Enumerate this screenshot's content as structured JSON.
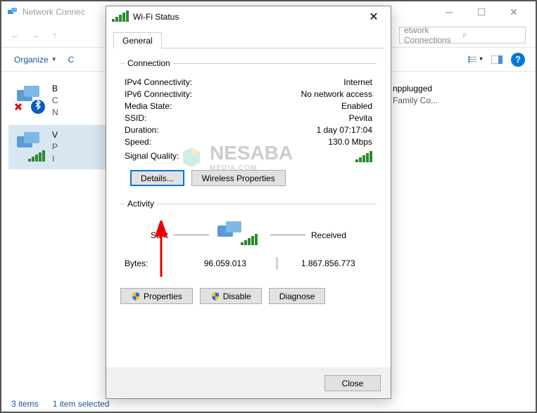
{
  "explorer": {
    "title": "Network Connec",
    "search_placeholder": "etwork Connections",
    "toolbar": {
      "organize": "Organize",
      "c": "C"
    },
    "connections": [
      {
        "name": "B",
        "line2": "C",
        "line3": "N",
        "bluetooth": true,
        "disabled": true
      },
      {
        "name": "V",
        "line2": "P",
        "line3": "I",
        "wifi": true,
        "selected": true
      }
    ],
    "right_conn": {
      "line2": "npplugged",
      "line3": "Family Co..."
    },
    "status": {
      "items": "3 items",
      "selected": "1 item selected"
    }
  },
  "dialog": {
    "title": "Wi-Fi Status",
    "tab": "General",
    "connection": {
      "legend": "Connection",
      "rows": [
        {
          "label": "IPv4 Connectivity:",
          "value": "Internet"
        },
        {
          "label": "IPv6 Connectivity:",
          "value": "No network access"
        },
        {
          "label": "Media State:",
          "value": "Enabled"
        },
        {
          "label": "SSID:",
          "value": "Pevita"
        },
        {
          "label": "Duration:",
          "value": "1 day 07:17:04"
        },
        {
          "label": "Speed:",
          "value": "130.0 Mbps"
        }
      ],
      "signal_label": "Signal Quality:",
      "details_btn": "Details...",
      "wireless_btn": "Wireless Properties"
    },
    "activity": {
      "legend": "Activity",
      "sent_label": "Sent",
      "received_label": "Received",
      "bytes_label": "Bytes:",
      "bytes_sent": "96.059.013",
      "bytes_received": "1.867.856.773"
    },
    "buttons": {
      "properties": "Properties",
      "disable": "Disable",
      "diagnose": "Diagnose",
      "close": "Close"
    }
  },
  "watermark": {
    "text": "NESABA",
    "sub": "MEDIA.COM"
  }
}
